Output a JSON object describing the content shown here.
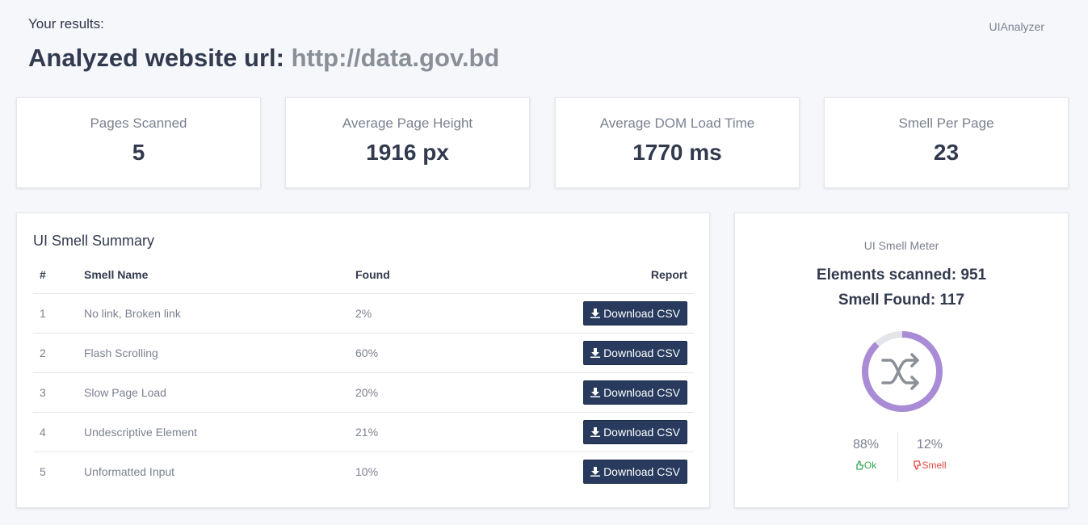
{
  "header": {
    "subtitle": "Your results:",
    "title_prefix": "Analyzed website url:",
    "url": "http://data.gov.bd",
    "brand": "UIAnalyzer"
  },
  "stats": [
    {
      "label": "Pages Scanned",
      "value": "5"
    },
    {
      "label": "Average Page Height",
      "value": "1916 px"
    },
    {
      "label": "Average DOM Load Time",
      "value": "1770 ms"
    },
    {
      "label": "Smell Per Page",
      "value": "23"
    }
  ],
  "summary": {
    "title": "UI Smell Summary",
    "columns": {
      "num": "#",
      "name": "Smell Name",
      "found": "Found",
      "report": "Report"
    },
    "rows": [
      {
        "num": "1",
        "name": "No link, Broken link",
        "found": "2%",
        "button": "Download CSV"
      },
      {
        "num": "2",
        "name": "Flash Scrolling",
        "found": "60%",
        "button": "Download CSV"
      },
      {
        "num": "3",
        "name": "Slow Page Load",
        "found": "20%",
        "button": "Download CSV"
      },
      {
        "num": "4",
        "name": "Undescriptive Element",
        "found": "21%",
        "button": "Download CSV"
      },
      {
        "num": "5",
        "name": "Unformatted Input",
        "found": "10%",
        "button": "Download CSV"
      }
    ],
    "button_icon": "download-icon"
  },
  "meter": {
    "title": "UI Smell Meter",
    "elements_scanned": "Elements scanned: 951",
    "smell_found": "Smell Found: 117",
    "gauge_icon": "shuffle-icon",
    "gauge_fraction": 0.88,
    "gauge_color": "#a98bd6",
    "ok_pct": "88%",
    "ok_label": "Ok",
    "ok_icon": "thumbs-up-icon",
    "smell_pct": "12%",
    "smell_label": "Smell",
    "smell_icon": "thumbs-down-icon"
  },
  "colors": {
    "button_bg": "#283b5e",
    "ok": "#34a853",
    "smell": "#e0483e"
  }
}
